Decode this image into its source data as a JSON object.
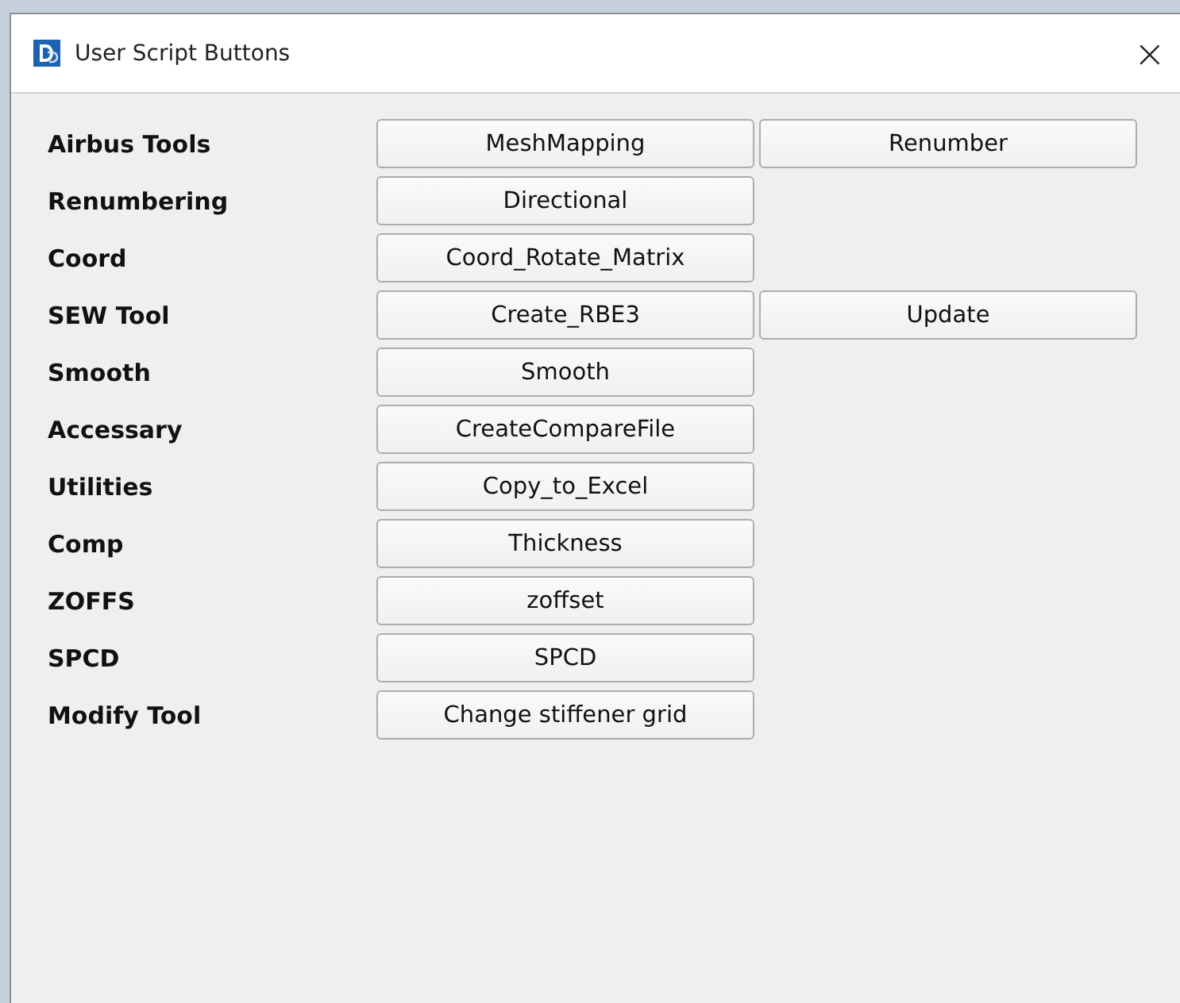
{
  "window": {
    "title": "User Script Buttons",
    "close": "×"
  },
  "rows": [
    {
      "label": "Airbus Tools",
      "buttons": [
        "MeshMapping",
        "Renumber"
      ]
    },
    {
      "label": "Renumbering",
      "buttons": [
        "Directional"
      ]
    },
    {
      "label": "Coord",
      "buttons": [
        "Coord_Rotate_Matrix"
      ]
    },
    {
      "label": "SEW Tool",
      "buttons": [
        "Create_RBE3",
        "Update"
      ]
    },
    {
      "label": "Smooth",
      "buttons": [
        "Smooth"
      ]
    },
    {
      "label": "Accessary",
      "buttons": [
        "CreateCompareFile"
      ]
    },
    {
      "label": "Utilities",
      "buttons": [
        "Copy_to_Excel"
      ]
    },
    {
      "label": "Comp",
      "buttons": [
        "Thickness"
      ]
    },
    {
      "label": "ZOFFS",
      "buttons": [
        "zoffset"
      ]
    },
    {
      "label": "SPCD",
      "buttons": [
        "SPCD"
      ]
    },
    {
      "label": "Modify Tool",
      "buttons": [
        "Change stiffener grid"
      ]
    }
  ]
}
